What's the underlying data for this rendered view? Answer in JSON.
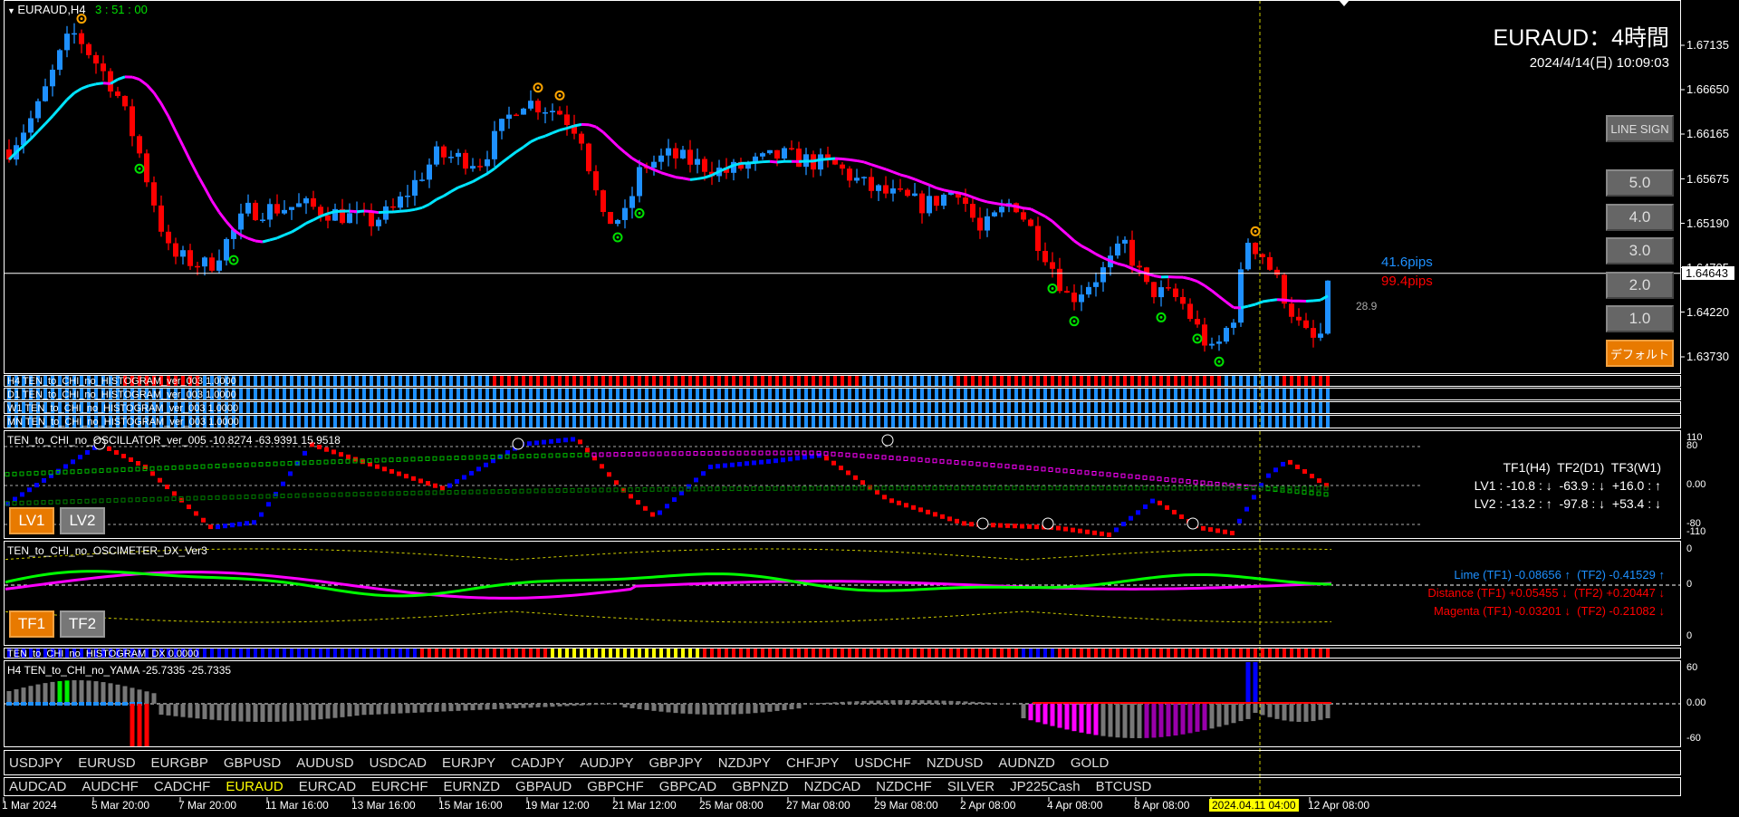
{
  "header": {
    "symbol_tf": "EURAUD,H4",
    "countdown": "3 : 51 : 00",
    "title": "EURAUD：4時間",
    "datetime": "2024/4/14(日) 10:09:03"
  },
  "colors": {
    "up": "#1e90ff",
    "down": "#ff0000",
    "ma_up": "#00e5ff",
    "ma_down": "#ff00ff",
    "accent": "#e87a00",
    "highlight": "#ffff00"
  },
  "price_axis": {
    "labels": [
      "1.67135",
      "1.66650",
      "1.66165",
      "1.65675",
      "1.65190",
      "1.64705",
      "1.64220",
      "1.63730"
    ],
    "values": [
      1.67135,
      1.6665,
      1.66165,
      1.65675,
      1.6519,
      1.64705,
      1.6422,
      1.6373
    ],
    "current": "1.64643",
    "current_value": 1.64643
  },
  "chart_data": {
    "type": "candlestick",
    "bars": 183,
    "close_path": [
      [
        0,
        1.65997
      ],
      [
        3.8,
        1.66417
      ],
      [
        7.7,
        1.67145
      ],
      [
        9.2,
        1.67266
      ],
      [
        14.6,
        1.6666
      ],
      [
        17.6,
        1.66056
      ],
      [
        22.2,
        1.64839
      ],
      [
        27.6,
        1.6472
      ],
      [
        33,
        1.65324
      ],
      [
        40.6,
        1.65383
      ],
      [
        49.8,
        1.65205
      ],
      [
        52.9,
        1.65324
      ],
      [
        59,
        1.65932
      ],
      [
        65.1,
        1.65871
      ],
      [
        70.5,
        1.66541
      ],
      [
        75.8,
        1.66417
      ],
      [
        78.9,
        1.66175
      ],
      [
        82,
        1.65205
      ],
      [
        85,
        1.65264
      ],
      [
        87.3,
        1.65809
      ],
      [
        91.2,
        1.65932
      ],
      [
        98.8,
        1.65749
      ],
      [
        106.5,
        1.65932
      ],
      [
        114.1,
        1.65809
      ],
      [
        118.7,
        1.65571
      ],
      [
        126.4,
        1.65383
      ],
      [
        131,
        1.65571
      ],
      [
        134,
        1.65086
      ],
      [
        138.6,
        1.65447
      ],
      [
        143.2,
        1.64839
      ],
      [
        146.3,
        1.64354
      ],
      [
        150.9,
        1.6466
      ],
      [
        154,
        1.64962
      ],
      [
        157,
        1.64476
      ],
      [
        161.6,
        1.64354
      ],
      [
        166.2,
        1.6375
      ],
      [
        169.3,
        1.64235
      ],
      [
        170.8,
        1.65027
      ],
      [
        173.1,
        1.64839
      ],
      [
        175.5,
        1.64476
      ],
      [
        178.5,
        1.63992
      ],
      [
        180.8,
        1.63869
      ],
      [
        182.3,
        1.64601
      ]
    ],
    "signals_top": [
      9.7,
      72.8,
      75.8,
      171.9
    ],
    "signals_bottom": [
      17.6,
      31,
      83.8,
      86.9,
      143.8,
      146.9,
      159,
      164,
      167
    ]
  },
  "overlay": {
    "pips_blue": "41.6pips",
    "pips_red": "99.4pips",
    "ma_value": "28.9"
  },
  "buttons": {
    "line_sign": "LINE SIGN",
    "b5": "5.0",
    "b4": "4.0",
    "b3": "3.0",
    "b2": "2.0",
    "b1": "1.0",
    "default": "デフォルト"
  },
  "histograms": {
    "h4": "H4 TEN_to_CHI_no_HISTOGRAM_ver_003 1.0000",
    "d1": "D1 TEN_to_CHI_no_HISTOGRAM_ver_003 1.0000",
    "w1": "W1 TEN_to_CHI_no_HISTOGRAM_ver_003 1.0000",
    "mn": "MN TEN_to_CHI_no_HISTOGRAM_ver_003 1.0000",
    "dx": "TEN_to_CHI_no_HISTOGRAM_DX 0.0000"
  },
  "oscillator": {
    "title": "TEN_to_CHI_no_OSCILLATOR_ver_005 -10.8274 -63.9391 15.9518",
    "lv1": "LV1",
    "lv2": "LV2",
    "header": "TF1(H4)  TF2(D1)  TF3(W1)",
    "row1": "LV1 : -10.8 : ↓  -63.9 : ↓  +16.0 : ↑",
    "row2": "LV2 : -13.2 : ↑  -97.8 : ↓  +53.4 : ↓",
    "axis": [
      "110",
      "80",
      "0.00",
      "-80",
      "-110"
    ]
  },
  "oscimeter": {
    "title": "TEN_to_CHI_no_OSCIMETER_DX_Ver3",
    "tf1": "TF1",
    "tf2": "TF2",
    "lime": "Lime (TF1) -0.08656 ↑  (TF2) -0.41529 ↑",
    "distance": "Distance (TF1) +0.05455 ↓  (TF2) +0.20447 ↓",
    "magenta": "Magenta (TF1) -0.03201 ↓  (TF2) -0.21082 ↓",
    "axis": [
      "0",
      "0",
      "0"
    ]
  },
  "yama": {
    "title": "H4  TEN_to_CHI_no_YAMA  -25.7335 -25.7335",
    "axis": [
      "60",
      "0.00",
      "-60"
    ]
  },
  "symbols_row1": [
    "USDJPY",
    "EURUSD",
    "EURGBP",
    "GBPUSD",
    "AUDUSD",
    "USDCAD",
    "EURJPY",
    "CADJPY",
    "AUDJPY",
    "GBPJPY",
    "NZDJPY",
    "CHFJPY",
    "USDCHF",
    "NZDUSD",
    "AUDNZD",
    "GOLD"
  ],
  "symbols_row2": [
    "AUDCAD",
    "AUDCHF",
    "CADCHF",
    "EURAUD",
    "EURCAD",
    "EURCHF",
    "EURNZD",
    "GBPAUD",
    "GBPCHF",
    "GBPCAD",
    "GBPNZD",
    "NZDCAD",
    "NZDCHF",
    "SILVER",
    "JP225Cash",
    "BTCUSD"
  ],
  "active_symbol": "EURAUD",
  "time_axis": [
    "1 Mar 2024",
    "5 Mar 20:00",
    "7 Mar 20:00",
    "11 Mar 16:00",
    "13 Mar 16:00",
    "15 Mar 16:00",
    "19 Mar 12:00",
    "21 Mar 12:00",
    "25 Mar 08:00",
    "27 Mar 08:00",
    "29 Mar 08:00",
    "2 Apr 08:00",
    "4 Apr 08:00",
    "8 Apr 08:00",
    "2024.04.11 04:00",
    "12 Apr 08:00"
  ]
}
